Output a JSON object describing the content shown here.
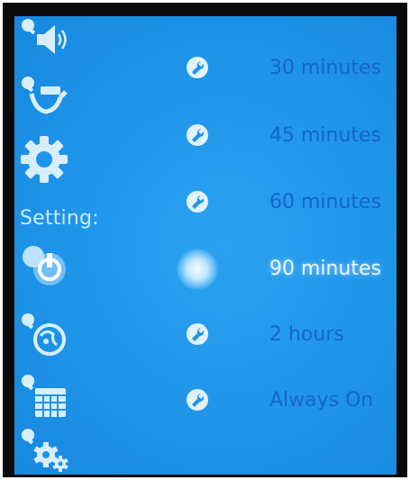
{
  "sidebar": {
    "label": "Setting:",
    "icons": [
      "sound-settings-icon",
      "hands-icon",
      "gear-icon",
      "power-icon",
      "globe-icon",
      "calendar-icon",
      "gears-icon"
    ]
  },
  "timeout_options": [
    {
      "label": "30 minutes",
      "selected": false
    },
    {
      "label": "45 minutes",
      "selected": false
    },
    {
      "label": "60 minutes",
      "selected": false
    },
    {
      "label": "90 minutes",
      "selected": true
    },
    {
      "label": "2 hours",
      "selected": false
    },
    {
      "label": "Always On",
      "selected": false
    }
  ],
  "colors": {
    "screen": "#1f95ea",
    "option_text": "#1565c8",
    "selected_text": "#e8f6ff",
    "icon": "#d8eeff"
  }
}
